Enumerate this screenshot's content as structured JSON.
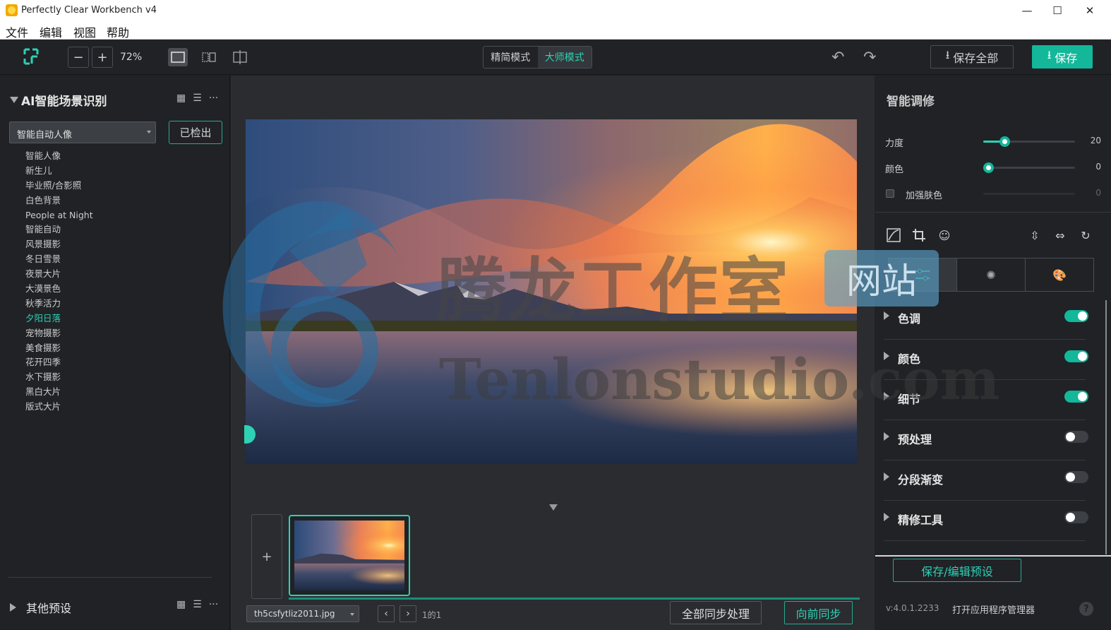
{
  "window": {
    "title": "Perfectly Clear Workbench v4",
    "minimize": "—",
    "maximize": "☐",
    "close": "✕"
  },
  "menu": [
    "文件",
    "编辑",
    "视图",
    "帮助"
  ],
  "toolbar": {
    "zoom_out": "−",
    "zoom_in": "+",
    "zoom": "72%",
    "modes": [
      "精简模式",
      "大师模式"
    ],
    "active_mode": "大师模式",
    "undo": "↶",
    "redo": "↷",
    "save_all": "保存全部",
    "save": "保存"
  },
  "left": {
    "section_title": "AI智能场景识别",
    "more": "···",
    "preset_value": "智能自动人像",
    "detect_button": "已检出",
    "scenes": [
      "智能人像",
      "新生儿",
      "毕业照/合影照",
      "白色背景",
      "People at Night",
      "智能自动",
      "风景摄影",
      "冬日雪景",
      "夜景大片",
      "大漠景色",
      "秋季活力",
      "夕阳日落",
      "宠物摄影",
      "美食摄影",
      "花开四季",
      "水下摄影",
      "黑白大片",
      "版式大片"
    ],
    "active_scene": "夕阳日落",
    "other_title": "其他预设"
  },
  "canvas": {
    "add_label": "+",
    "file_name": "th5csfytliz2011.jpg",
    "prev": "‹",
    "next": "›",
    "page_info": "1的1",
    "sync_all": "全部同步处理",
    "sync_forward": "向前同步"
  },
  "watermark": {
    "cn": "腾龙工作室",
    "box": "网站",
    "en": "Tenlonstudio.com"
  },
  "right": {
    "title": "智能调修",
    "sliders": [
      {
        "label": "力度",
        "value": "20",
        "level": 0.23
      },
      {
        "label": "颜色",
        "value": "0",
        "level": 0.05
      },
      {
        "label": "加强肤色",
        "value": "0",
        "level": 0
      }
    ],
    "adjustments": [
      {
        "label": "色调",
        "on": true
      },
      {
        "label": "颜色",
        "on": true
      },
      {
        "label": "细节",
        "on": true
      },
      {
        "label": "预处理",
        "on": false
      },
      {
        "label": "分段渐变",
        "on": false
      },
      {
        "label": "精修工具",
        "on": false
      }
    ],
    "preset_button": "保存/编辑预设",
    "version": "v:4.0.1.2233",
    "app_manager": "打开应用程序管理器",
    "help": "?"
  },
  "colors": {
    "accent": "#13b79a",
    "accent_text": "#2ed1b4",
    "panel": "#202226",
    "canvas": "#2a2c30"
  }
}
